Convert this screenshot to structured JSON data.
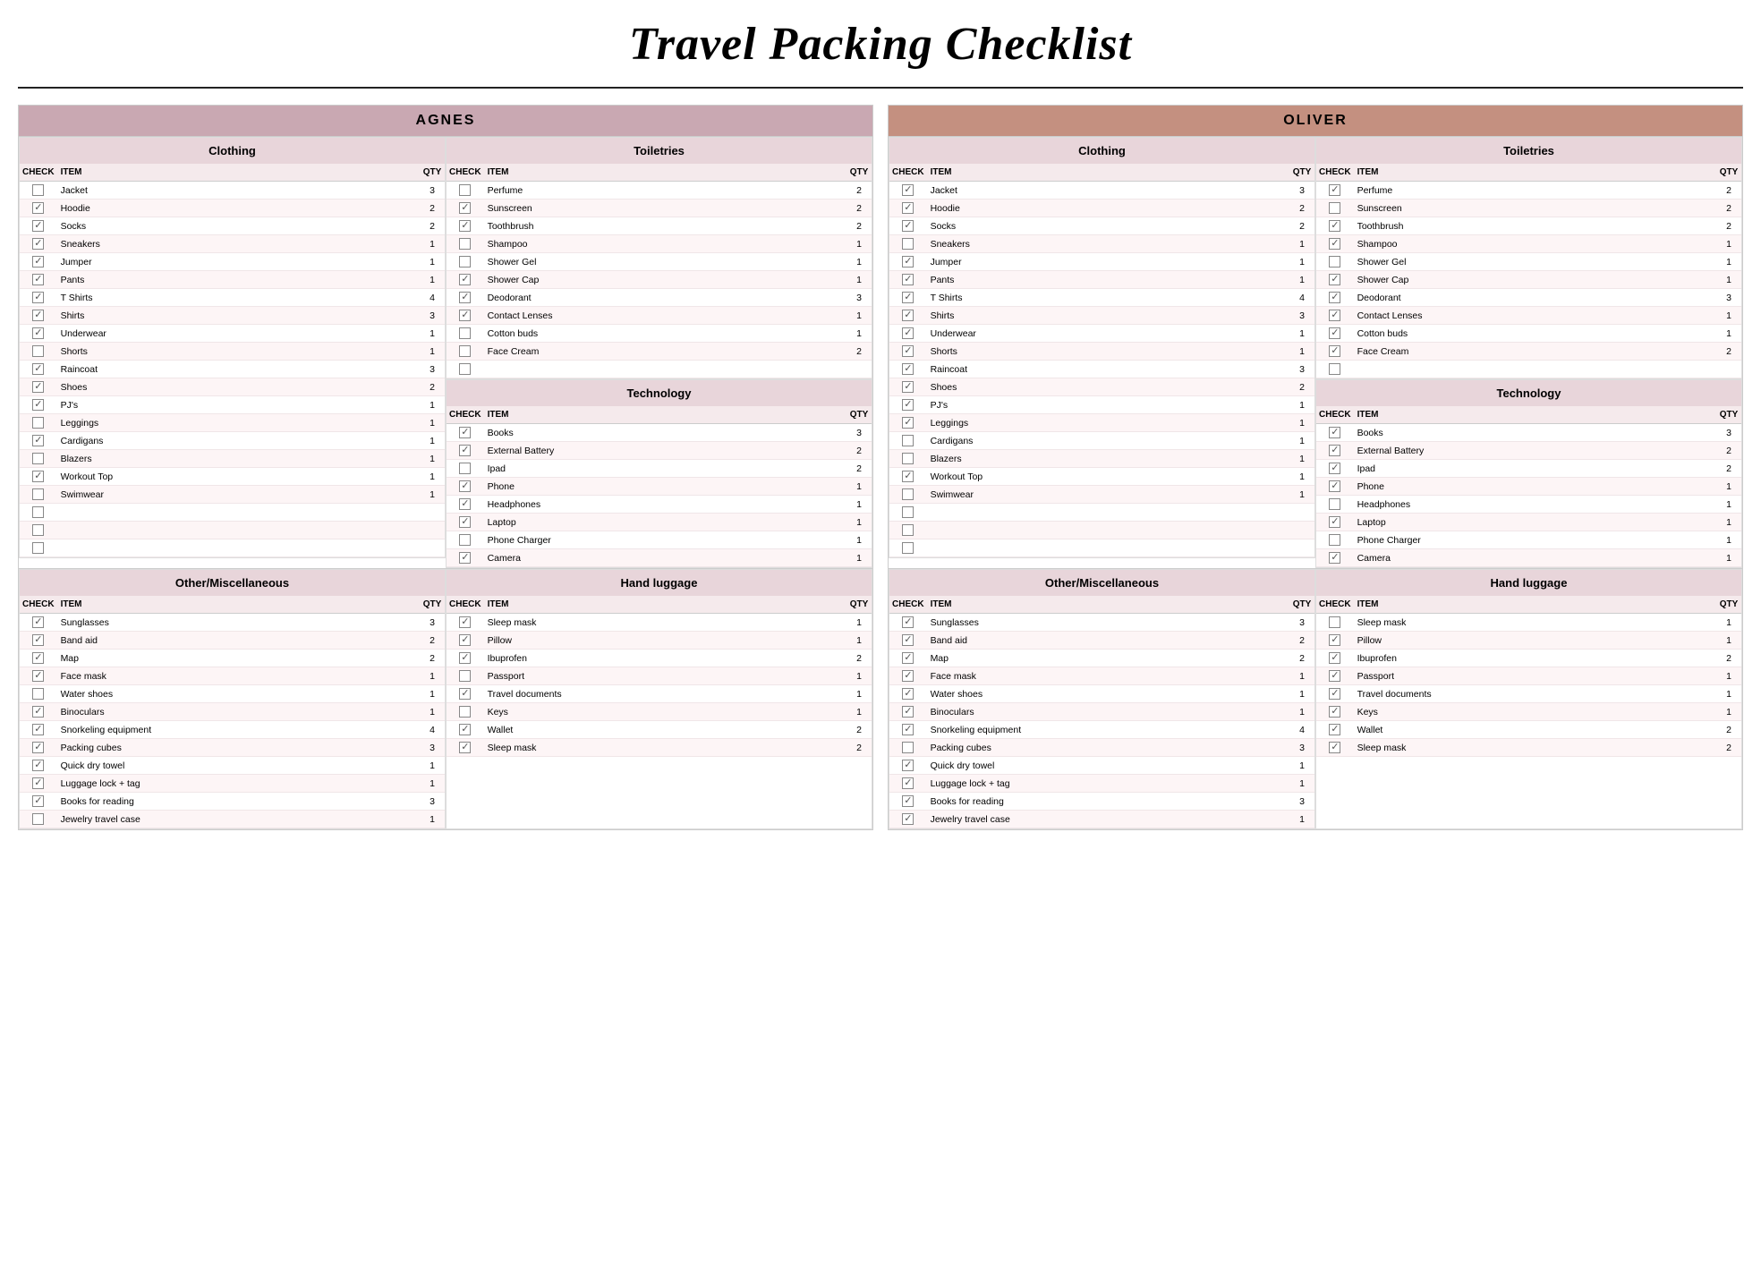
{
  "title": "Travel Packing Checklist",
  "persons": [
    {
      "name": "AGNES",
      "headerClass": "agnes-header",
      "clothing": {
        "title": "Clothing",
        "columns": [
          "CHECK",
          "ITEM",
          "QTY"
        ],
        "rows": [
          {
            "checked": false,
            "item": "Jacket",
            "qty": 3
          },
          {
            "checked": true,
            "item": "Hoodie",
            "qty": 2
          },
          {
            "checked": true,
            "item": "Socks",
            "qty": 2
          },
          {
            "checked": true,
            "item": "Sneakers",
            "qty": 1
          },
          {
            "checked": true,
            "item": "Jumper",
            "qty": 1
          },
          {
            "checked": true,
            "item": "Pants",
            "qty": 1
          },
          {
            "checked": true,
            "item": "T Shirts",
            "qty": 4
          },
          {
            "checked": true,
            "item": "Shirts",
            "qty": 3
          },
          {
            "checked": true,
            "item": "Underwear",
            "qty": 1
          },
          {
            "checked": false,
            "item": "Shorts",
            "qty": 1
          },
          {
            "checked": true,
            "item": "Raincoat",
            "qty": 3
          },
          {
            "checked": true,
            "item": "Shoes",
            "qty": 2
          },
          {
            "checked": true,
            "item": "PJ's",
            "qty": 1
          },
          {
            "checked": false,
            "item": "Leggings",
            "qty": 1
          },
          {
            "checked": true,
            "item": "Cardigans",
            "qty": 1
          },
          {
            "checked": false,
            "item": "Blazers",
            "qty": 1
          },
          {
            "checked": true,
            "item": "Workout Top",
            "qty": 1
          },
          {
            "checked": false,
            "item": "Swimwear",
            "qty": 1
          },
          {
            "checked": false,
            "item": "",
            "qty": null
          },
          {
            "checked": false,
            "item": "",
            "qty": null
          },
          {
            "checked": false,
            "item": "",
            "qty": null
          }
        ]
      },
      "toiletries": {
        "title": "Toiletries",
        "columns": [
          "CHECK",
          "ITEM",
          "QTY"
        ],
        "rows": [
          {
            "checked": false,
            "item": "Perfume",
            "qty": 2
          },
          {
            "checked": true,
            "item": "Sunscreen",
            "qty": 2
          },
          {
            "checked": true,
            "item": "Toothbrush",
            "qty": 2
          },
          {
            "checked": false,
            "item": "Shampoo",
            "qty": 1
          },
          {
            "checked": false,
            "item": "Shower Gel",
            "qty": 1
          },
          {
            "checked": true,
            "item": "Shower Cap",
            "qty": 1
          },
          {
            "checked": true,
            "item": "Deodorant",
            "qty": 3
          },
          {
            "checked": true,
            "item": "Contact Lenses",
            "qty": 1
          },
          {
            "checked": false,
            "item": "Cotton buds",
            "qty": 1
          },
          {
            "checked": false,
            "item": "Face Cream",
            "qty": 2
          },
          {
            "checked": false,
            "item": "",
            "qty": null
          }
        ]
      },
      "technology": {
        "title": "Technology",
        "columns": [
          "CHECK",
          "ITEM",
          "QTY"
        ],
        "rows": [
          {
            "checked": true,
            "item": "Books",
            "qty": 3
          },
          {
            "checked": true,
            "item": "External Battery",
            "qty": 2
          },
          {
            "checked": false,
            "item": "Ipad",
            "qty": 2
          },
          {
            "checked": true,
            "item": "Phone",
            "qty": 1
          },
          {
            "checked": true,
            "item": "Headphones",
            "qty": 1
          },
          {
            "checked": true,
            "item": "Laptop",
            "qty": 1
          },
          {
            "checked": false,
            "item": "Phone Charger",
            "qty": 1
          },
          {
            "checked": true,
            "item": "Camera",
            "qty": 1
          }
        ]
      },
      "misc": {
        "title": "Other/Miscellaneous",
        "columns": [
          "CHECK",
          "ITEM",
          "QTY"
        ],
        "rows": [
          {
            "checked": true,
            "item": "Sunglasses",
            "qty": 3
          },
          {
            "checked": true,
            "item": "Band aid",
            "qty": 2
          },
          {
            "checked": true,
            "item": "Map",
            "qty": 2
          },
          {
            "checked": true,
            "item": "Face mask",
            "qty": 1
          },
          {
            "checked": false,
            "item": "Water shoes",
            "qty": 1
          },
          {
            "checked": true,
            "item": "Binoculars",
            "qty": 1
          },
          {
            "checked": true,
            "item": "Snorkeling equipment",
            "qty": 4
          },
          {
            "checked": true,
            "item": "Packing cubes",
            "qty": 3
          },
          {
            "checked": true,
            "item": "Quick dry towel",
            "qty": 1
          },
          {
            "checked": true,
            "item": "Luggage lock + tag",
            "qty": 1
          },
          {
            "checked": true,
            "item": "Books for reading",
            "qty": 3
          },
          {
            "checked": false,
            "item": "Jewelry travel case",
            "qty": 1
          }
        ]
      },
      "handluggage": {
        "title": "Hand luggage",
        "columns": [
          "CHECK",
          "ITEM",
          "QTY"
        ],
        "rows": [
          {
            "checked": true,
            "item": "Sleep mask",
            "qty": 1
          },
          {
            "checked": true,
            "item": "Pillow",
            "qty": 1
          },
          {
            "checked": true,
            "item": "Ibuprofen",
            "qty": 2
          },
          {
            "checked": false,
            "item": "Passport",
            "qty": 1
          },
          {
            "checked": true,
            "item": "Travel documents",
            "qty": 1
          },
          {
            "checked": false,
            "item": "Keys",
            "qty": 1
          },
          {
            "checked": true,
            "item": "Wallet",
            "qty": 2
          },
          {
            "checked": true,
            "item": "Sleep mask",
            "qty": 2
          }
        ]
      }
    },
    {
      "name": "OLIVER",
      "headerClass": "oliver-header",
      "clothing": {
        "title": "Clothing",
        "columns": [
          "CHECK",
          "ITEM",
          "QTY"
        ],
        "rows": [
          {
            "checked": true,
            "item": "Jacket",
            "qty": 3
          },
          {
            "checked": true,
            "item": "Hoodie",
            "qty": 2
          },
          {
            "checked": true,
            "item": "Socks",
            "qty": 2
          },
          {
            "checked": false,
            "item": "Sneakers",
            "qty": 1
          },
          {
            "checked": true,
            "item": "Jumper",
            "qty": 1
          },
          {
            "checked": true,
            "item": "Pants",
            "qty": 1
          },
          {
            "checked": true,
            "item": "T Shirts",
            "qty": 4
          },
          {
            "checked": true,
            "item": "Shirts",
            "qty": 3
          },
          {
            "checked": true,
            "item": "Underwear",
            "qty": 1
          },
          {
            "checked": true,
            "item": "Shorts",
            "qty": 1
          },
          {
            "checked": true,
            "item": "Raincoat",
            "qty": 3
          },
          {
            "checked": true,
            "item": "Shoes",
            "qty": 2
          },
          {
            "checked": true,
            "item": "PJ's",
            "qty": 1
          },
          {
            "checked": true,
            "item": "Leggings",
            "qty": 1
          },
          {
            "checked": false,
            "item": "Cardigans",
            "qty": 1
          },
          {
            "checked": false,
            "item": "Blazers",
            "qty": 1
          },
          {
            "checked": true,
            "item": "Workout Top",
            "qty": 1
          },
          {
            "checked": false,
            "item": "Swimwear",
            "qty": 1
          },
          {
            "checked": false,
            "item": "",
            "qty": null
          },
          {
            "checked": false,
            "item": "",
            "qty": null
          },
          {
            "checked": false,
            "item": "",
            "qty": null
          }
        ]
      },
      "toiletries": {
        "title": "Toiletries",
        "columns": [
          "CHECK",
          "ITEM",
          "QTY"
        ],
        "rows": [
          {
            "checked": true,
            "item": "Perfume",
            "qty": 2
          },
          {
            "checked": false,
            "item": "Sunscreen",
            "qty": 2
          },
          {
            "checked": true,
            "item": "Toothbrush",
            "qty": 2
          },
          {
            "checked": true,
            "item": "Shampoo",
            "qty": 1
          },
          {
            "checked": false,
            "item": "Shower Gel",
            "qty": 1
          },
          {
            "checked": true,
            "item": "Shower Cap",
            "qty": 1
          },
          {
            "checked": true,
            "item": "Deodorant",
            "qty": 3
          },
          {
            "checked": true,
            "item": "Contact Lenses",
            "qty": 1
          },
          {
            "checked": true,
            "item": "Cotton buds",
            "qty": 1
          },
          {
            "checked": true,
            "item": "Face Cream",
            "qty": 2
          },
          {
            "checked": false,
            "item": "",
            "qty": null
          }
        ]
      },
      "technology": {
        "title": "Technology",
        "columns": [
          "CHECK",
          "ITEM",
          "QTY"
        ],
        "rows": [
          {
            "checked": true,
            "item": "Books",
            "qty": 3
          },
          {
            "checked": true,
            "item": "External Battery",
            "qty": 2
          },
          {
            "checked": true,
            "item": "Ipad",
            "qty": 2
          },
          {
            "checked": true,
            "item": "Phone",
            "qty": 1
          },
          {
            "checked": false,
            "item": "Headphones",
            "qty": 1
          },
          {
            "checked": true,
            "item": "Laptop",
            "qty": 1
          },
          {
            "checked": false,
            "item": "Phone Charger",
            "qty": 1
          },
          {
            "checked": true,
            "item": "Camera",
            "qty": 1
          }
        ]
      },
      "misc": {
        "title": "Other/Miscellaneous",
        "columns": [
          "CHECK",
          "ITEM",
          "QTY"
        ],
        "rows": [
          {
            "checked": true,
            "item": "Sunglasses",
            "qty": 3
          },
          {
            "checked": true,
            "item": "Band aid",
            "qty": 2
          },
          {
            "checked": true,
            "item": "Map",
            "qty": 2
          },
          {
            "checked": true,
            "item": "Face mask",
            "qty": 1
          },
          {
            "checked": true,
            "item": "Water shoes",
            "qty": 1
          },
          {
            "checked": true,
            "item": "Binoculars",
            "qty": 1
          },
          {
            "checked": true,
            "item": "Snorkeling equipment",
            "qty": 4
          },
          {
            "checked": false,
            "item": "Packing cubes",
            "qty": 3
          },
          {
            "checked": true,
            "item": "Quick dry towel",
            "qty": 1
          },
          {
            "checked": true,
            "item": "Luggage lock + tag",
            "qty": 1
          },
          {
            "checked": true,
            "item": "Books for reading",
            "qty": 3
          },
          {
            "checked": true,
            "item": "Jewelry travel case",
            "qty": 1
          }
        ]
      },
      "handluggage": {
        "title": "Hand luggage",
        "columns": [
          "CHECK",
          "ITEM",
          "QTY"
        ],
        "rows": [
          {
            "checked": false,
            "item": "Sleep mask",
            "qty": 1
          },
          {
            "checked": true,
            "item": "Pillow",
            "qty": 1
          },
          {
            "checked": true,
            "item": "Ibuprofen",
            "qty": 2
          },
          {
            "checked": true,
            "item": "Passport",
            "qty": 1
          },
          {
            "checked": true,
            "item": "Travel documents",
            "qty": 1
          },
          {
            "checked": true,
            "item": "Keys",
            "qty": 1
          },
          {
            "checked": true,
            "item": "Wallet",
            "qty": 2
          },
          {
            "checked": true,
            "item": "Sleep mask",
            "qty": 2
          }
        ]
      }
    }
  ],
  "labels": {
    "check": "CHECK",
    "item": "ITEM",
    "qty": "QTY"
  }
}
